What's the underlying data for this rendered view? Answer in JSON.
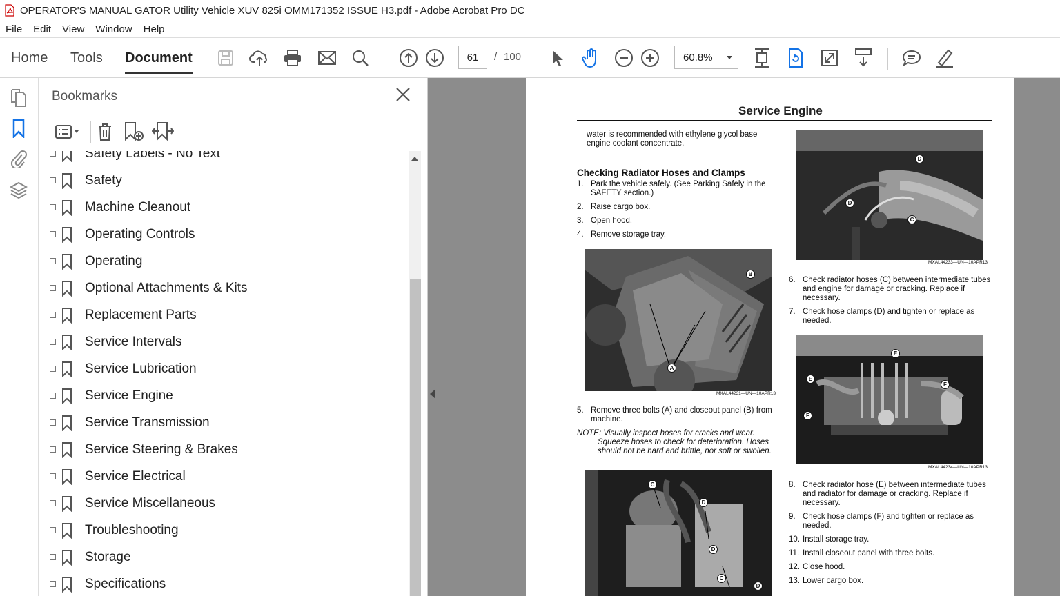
{
  "window": {
    "title": "OPERATOR'S MANUAL GATOR Utility Vehicle XUV 825i OMM171352 ISSUE H3.pdf - Adobe Acrobat Pro DC"
  },
  "menu": [
    "File",
    "Edit",
    "View",
    "Window",
    "Help"
  ],
  "toolbar": {
    "tabs": [
      "Home",
      "Tools",
      "Document"
    ],
    "active_tab": "Document",
    "page_current": "61",
    "page_separator": "/",
    "page_total": "100",
    "zoom": "60.8%",
    "icons": [
      "save-icon",
      "cloud-upload-icon",
      "print-icon",
      "mail-icon",
      "search-icon",
      "prev-page-icon",
      "next-page-icon",
      "select-cursor-icon",
      "hand-tool-icon",
      "zoom-out-icon",
      "zoom-in-icon",
      "fit-page-icon",
      "rotate-icon",
      "fullscreen-icon",
      "scroll-mode-icon",
      "comment-icon",
      "highlight-pen-icon"
    ]
  },
  "rail": {
    "icons": [
      "pages-icon",
      "bookmark-icon",
      "attachment-icon",
      "layers-icon"
    ]
  },
  "bookmarks": {
    "title": "Bookmarks",
    "items": [
      "Safety Labels - No Text",
      "Safety",
      "Machine Cleanout",
      "Operating Controls",
      "Operating",
      "Optional Attachments & Kits",
      "Replacement Parts",
      "Service Intervals",
      "Service Lubrication",
      "Service Engine",
      "Service Transmission",
      "Service Steering & Brakes",
      "Service Electrical",
      "Service Miscellaneous",
      "Troubleshooting",
      "Storage",
      "Specifications"
    ]
  },
  "document": {
    "title": "Service Engine",
    "intro": [
      "water is recommended with ethylene glycol base",
      "engine coolant concentrate."
    ],
    "section_heading": "Checking Radiator Hoses and Clamps",
    "steps_a": [
      {
        "n": "1.",
        "lines": [
          "Park the vehicle safely. (See Parking Safely in the",
          "SAFETY section.)"
        ]
      },
      {
        "n": "2.",
        "lines": [
          "Raise cargo box."
        ]
      },
      {
        "n": "3.",
        "lines": [
          "Open hood."
        ]
      },
      {
        "n": "4.",
        "lines": [
          "Remove storage tray."
        ]
      }
    ],
    "step_5": {
      "n": "5.",
      "lines": [
        "Remove three bolts (A) and closeout panel (B) from",
        "machine."
      ]
    },
    "note": [
      "NOTE: Visually inspect hoses for cracks and wear.",
      "Squeeze hoses to check for deterioration. Hoses",
      "should not be hard and brittle, nor soft or swollen."
    ],
    "steps_b": [
      {
        "n": "6.",
        "lines": [
          "Check radiator hoses (C) between intermediate tubes",
          "and engine for damage or cracking. Replace if",
          "necessary."
        ]
      },
      {
        "n": "7.",
        "lines": [
          "Check hose clamps (D) and tighten or replace as",
          "needed."
        ]
      }
    ],
    "steps_c": [
      {
        "n": "8.",
        "lines": [
          "Check radiator hose (E) between intermediate tubes",
          "and radiator for damage or cracking. Replace if",
          "necessary."
        ]
      },
      {
        "n": "9.",
        "lines": [
          "Check hose clamps (F) and tighten or replace as",
          "needed."
        ]
      },
      {
        "n": "10.",
        "lines": [
          "Install storage tray."
        ]
      },
      {
        "n": "11.",
        "lines": [
          "Install closeout panel with three bolts."
        ]
      },
      {
        "n": "12.",
        "lines": [
          "Close hood."
        ]
      },
      {
        "n": "13.",
        "lines": [
          "Lower cargo box."
        ]
      }
    ],
    "captions": {
      "img1": "MXAL44231—UN—10APR13",
      "img2": "MXAL44233—UN—10APR13",
      "img3": "MXAL44234—UN—10APR13"
    },
    "callouts": {
      "img1": [
        "B",
        "A"
      ],
      "img2": [
        "D",
        "D",
        "C"
      ],
      "img3": [
        "E",
        "E",
        "F",
        "F"
      ],
      "img4": [
        "C",
        "D",
        "D",
        "C",
        "D"
      ]
    }
  }
}
